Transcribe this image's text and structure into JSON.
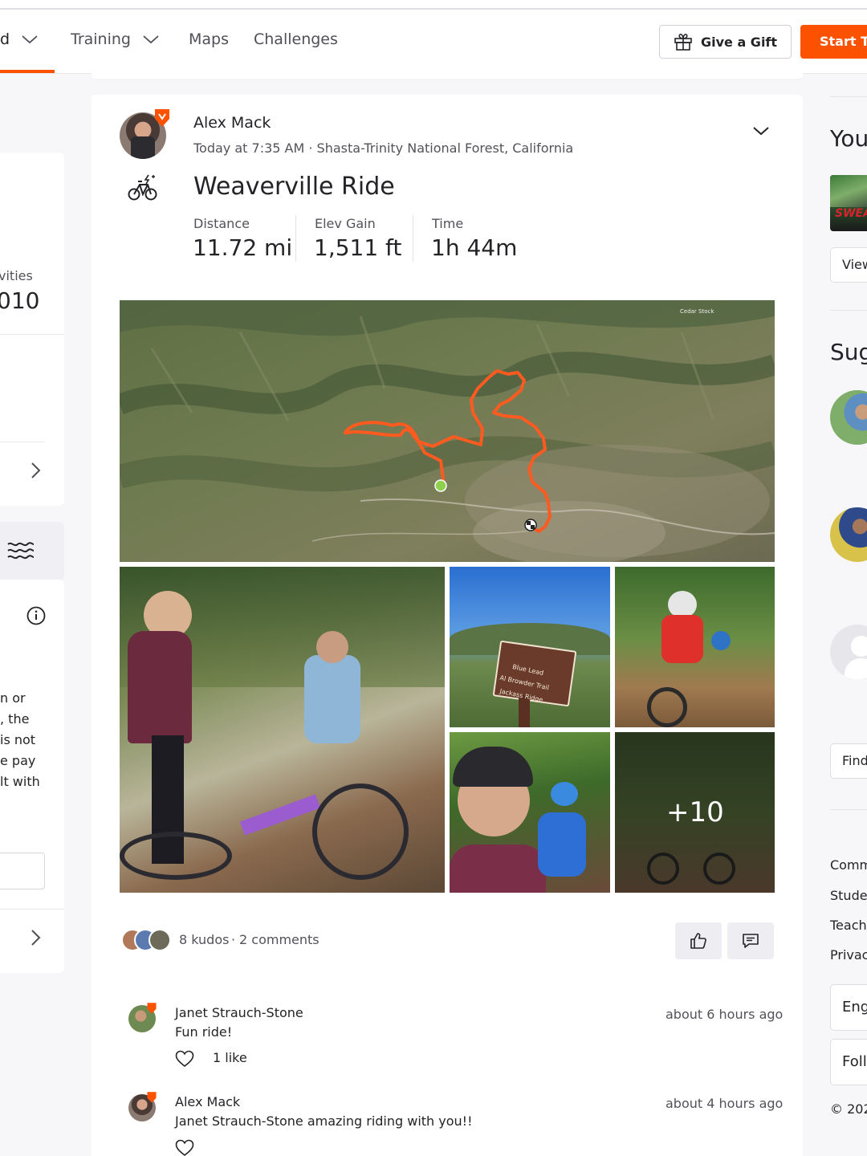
{
  "nav": {
    "dashboard_partial": "d",
    "training": "Training",
    "maps": "Maps",
    "challenges": "Challenges",
    "gift_label": "Give a Gift",
    "start_label": "Start Tr"
  },
  "left_sidebar": {
    "activities_label_partial": "vities",
    "activities_value_partial": "010",
    "notice_lines": [
      "n or",
      ", the",
      "is not",
      "e pay",
      "lt with"
    ]
  },
  "activity": {
    "athlete_name": "Alex Mack",
    "meta": "Today at 7:35 AM · Shasta-Trinity National Forest, California",
    "title": "Weaverville Ride",
    "stats": [
      {
        "label": "Distance",
        "value": "11.72 mi"
      },
      {
        "label": "Elev Gain",
        "value": "1,511 ft"
      },
      {
        "label": "Time",
        "value": "1h 44m"
      }
    ],
    "map_label": "Cedar Stock",
    "trail_sign": [
      "Blue Lead",
      "Al Browder Trail",
      "Jackass Ridge"
    ],
    "more_photos": "+10",
    "kudos_text": "8 kudos",
    "separator": "·",
    "comments_text": "2 comments"
  },
  "comments": [
    {
      "author": "Janet Strauch-Stone",
      "text": "Fun ride!",
      "time": "about 6 hours ago",
      "likes": "1 like"
    },
    {
      "author": "Alex Mack",
      "text": "Janet Strauch-Stone amazing riding with you!!",
      "time": "about 4 hours ago",
      "likes": ""
    }
  ],
  "right_sidebar": {
    "your_partial": "You",
    "club_badge_partial": "SWEA",
    "view_partial": "View",
    "suggested_partial": "Sug",
    "find_partial": "Find",
    "links_partial": [
      "Comm",
      "Stude",
      "Teach",
      "Privac"
    ],
    "language_partial": "Eng",
    "follow_partial": "Foll",
    "copyright_partial": "© 202"
  },
  "colors": {
    "brand_orange": "#fc5200",
    "route": "#ff5a1f",
    "start_marker": "#8fd14f"
  }
}
